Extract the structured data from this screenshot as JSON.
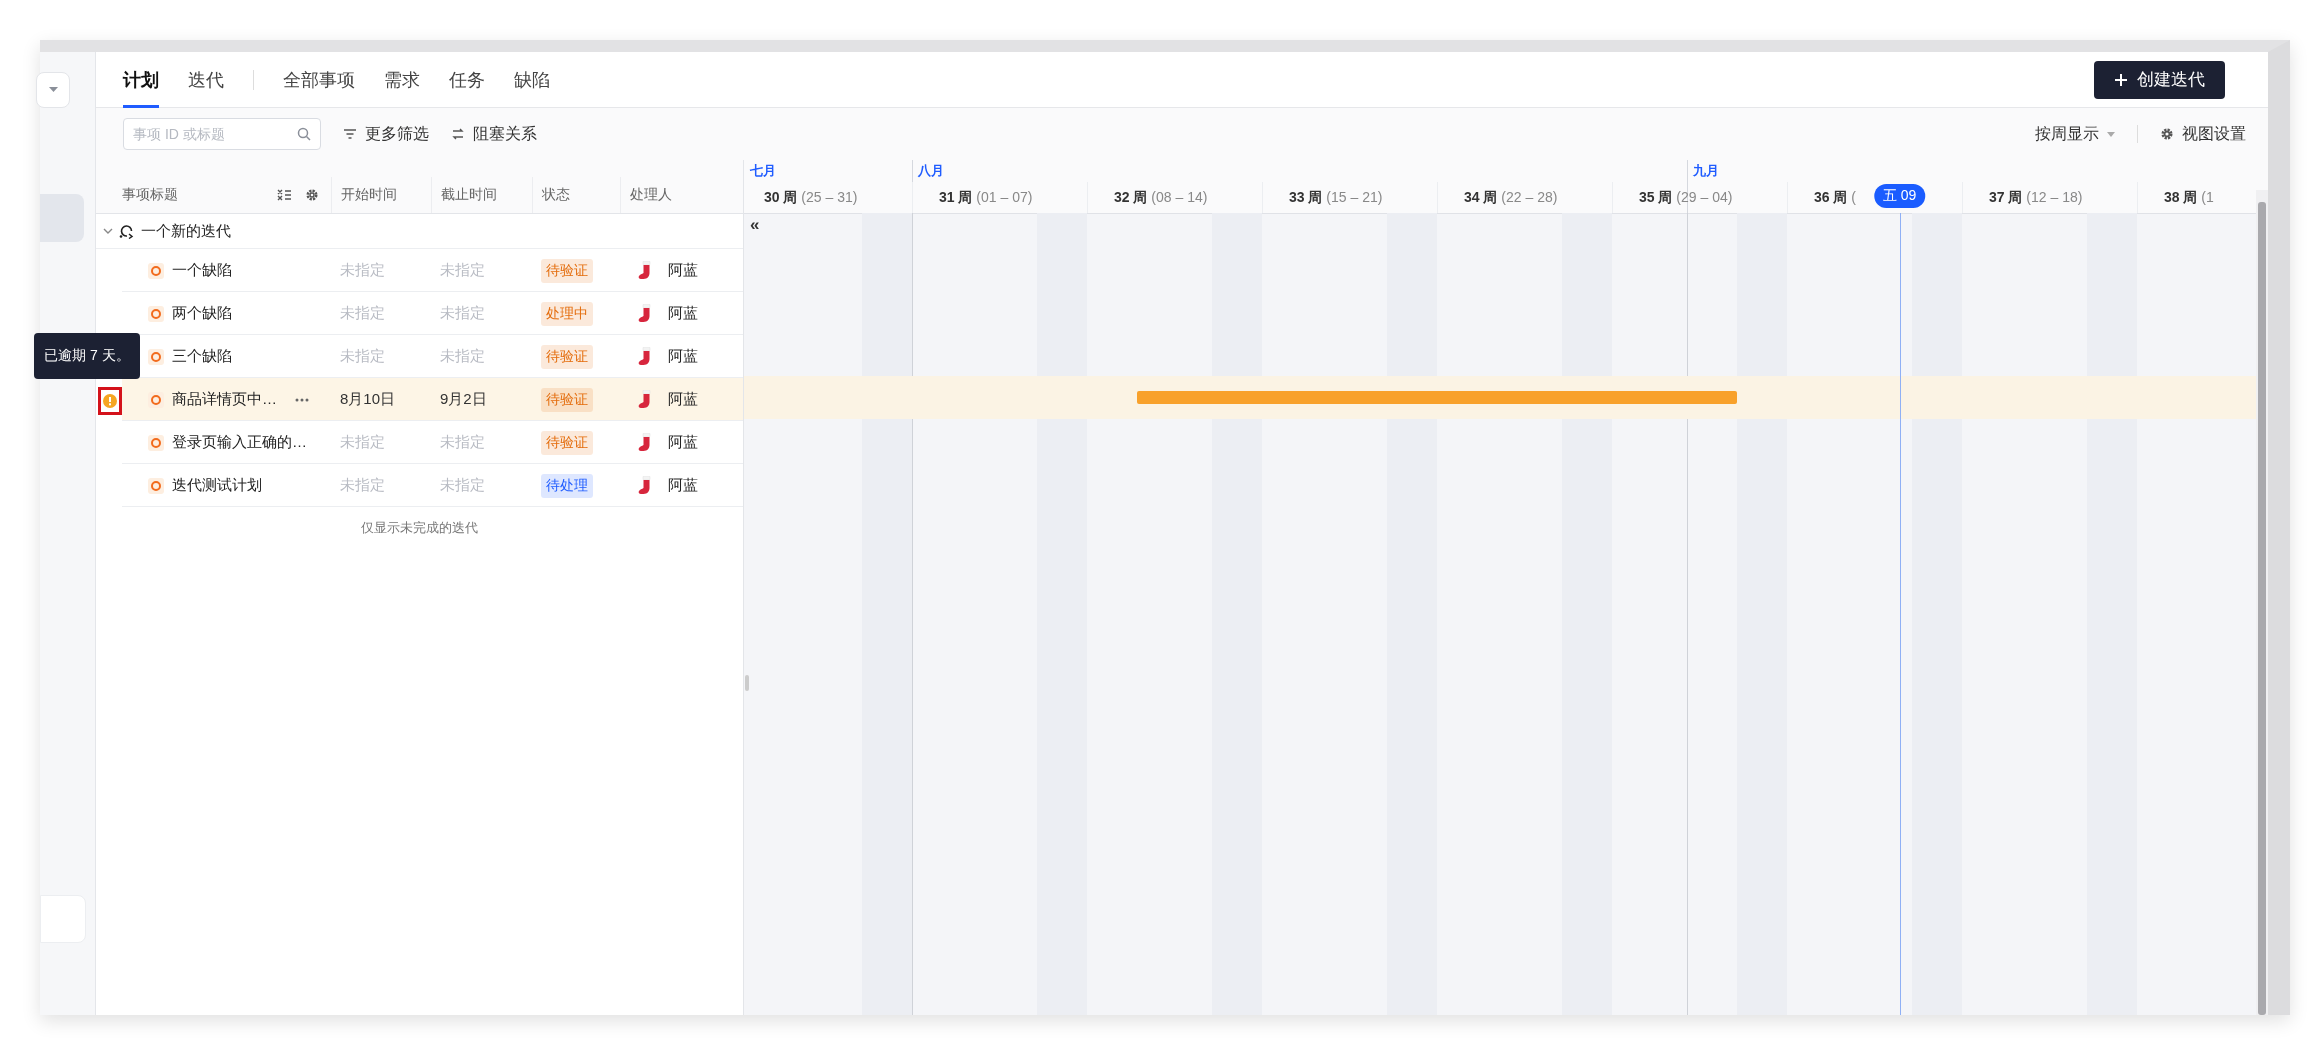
{
  "view_tabs": [
    {
      "label": "计划",
      "selected": true
    },
    {
      "label": "迭代",
      "selected": false
    }
  ],
  "type_tabs": [
    {
      "label": "全部事项",
      "selected": false
    },
    {
      "label": "需求",
      "selected": false
    },
    {
      "label": "任务",
      "selected": false
    },
    {
      "label": "缺陷",
      "selected": false
    }
  ],
  "create_button": "创建迭代",
  "toolbar": {
    "search_placeholder": "事项 ID 或标题",
    "filter": "更多筛选",
    "blocking": "阻塞关系",
    "scale": "按周显示",
    "view_settings": "视图设置"
  },
  "table": {
    "columns": [
      "事项标题",
      "开始时间",
      "截止时间",
      "状态",
      "处理人"
    ],
    "group": {
      "title": "一个新的迭代",
      "expanded": true
    },
    "rows": [
      {
        "title": "一个缺陷",
        "start": "未指定",
        "end": "未指定",
        "dates_set": false,
        "status": "待验证",
        "color": "#e46d0d",
        "assignee": "阿蓝",
        "selected": false,
        "overdue": false
      },
      {
        "title": "两个缺陷",
        "start": "未指定",
        "end": "未指定",
        "dates_set": false,
        "status": "处理中",
        "color": "#e46d0d",
        "assignee": "阿蓝",
        "selected": false,
        "overdue": false
      },
      {
        "title": "三个缺陷",
        "start": "未指定",
        "end": "未指定",
        "dates_set": false,
        "status": "待验证",
        "color": "#e46d0d",
        "assignee": "阿蓝",
        "selected": false,
        "overdue": false
      },
      {
        "title": "商品详情页中…",
        "start": "8月10日",
        "end": "9月2日",
        "dates_set": true,
        "status": "待验证",
        "color": "#e46d0d",
        "assignee": "阿蓝",
        "selected": true,
        "overdue": true,
        "tooltip": "已逾期 7 天。"
      },
      {
        "title": "登录页输入正确的…",
        "start": "未指定",
        "end": "未指定",
        "dates_set": false,
        "status": "待验证",
        "color": "#e46d0d",
        "assignee": "阿蓝",
        "selected": false,
        "overdue": false
      },
      {
        "title": "迭代测试计划",
        "start": "未指定",
        "end": "未指定",
        "dates_set": false,
        "status": "待处理",
        "color": "#1f5cff",
        "assignee": "阿蓝",
        "selected": false,
        "overdue": false
      }
    ],
    "footer": "仅显示未完成的迭代"
  },
  "timeline": {
    "collapse": "«",
    "months": [
      "七月",
      "八月",
      "九月"
    ],
    "weeks": [
      {
        "label": "30 周",
        "range": "(25 – 31)"
      },
      {
        "label": "31 周",
        "range": "(01 – 07)"
      },
      {
        "label": "32 周",
        "range": "(08 – 14)"
      },
      {
        "label": "33 周",
        "range": "(15 – 21)"
      },
      {
        "label": "34 周",
        "range": "(22 – 28)"
      },
      {
        "label": "35 周",
        "range": "(29 – 04)"
      },
      {
        "label": "36 周",
        "range": "("
      },
      {
        "label": "37 周",
        "range": "(12 – 18)"
      },
      {
        "label": "38 周",
        "range": "(1"
      }
    ],
    "today": "五 09"
  }
}
